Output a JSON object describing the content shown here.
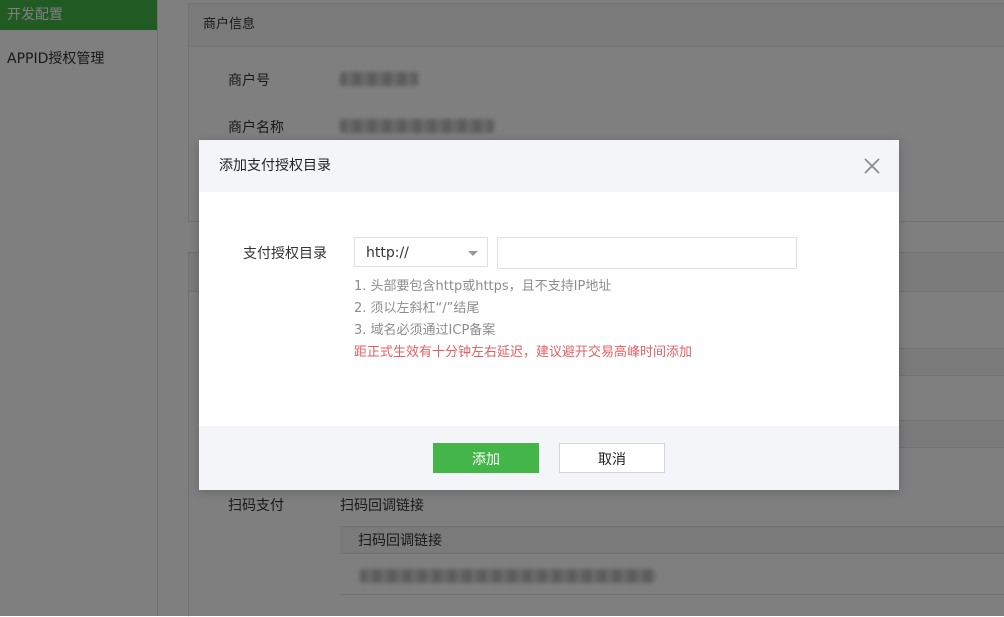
{
  "sidebar": {
    "active_label": "开发配置",
    "items": [
      {
        "label": "APPID授权管理"
      }
    ]
  },
  "merchant_card": {
    "title": "商户信息",
    "rows": [
      {
        "label": "商户号"
      },
      {
        "label": "商户名称"
      }
    ]
  },
  "scan_pay": {
    "label": "扫码支付",
    "value_label": "扫码回调链接",
    "sub_header": "扫码回调链接"
  },
  "modal": {
    "title": "添加支付授权目录",
    "field_label": "支付授权目录",
    "protocol_selected": "http://",
    "url_value": "",
    "tips": [
      "1. 头部要包含http或https，且不支持IP地址",
      "2. 须以左斜杠“/”结尾",
      "3. 域名必须通过ICP备案"
    ],
    "warning": "距正式生效有十分钟左右延迟，建议避开交易高峰时间添加",
    "confirm_label": "添加",
    "cancel_label": "取消",
    "close_icon": "close-icon"
  },
  "colors": {
    "brand_green": "#44b549",
    "warning_red": "#e15f63"
  }
}
